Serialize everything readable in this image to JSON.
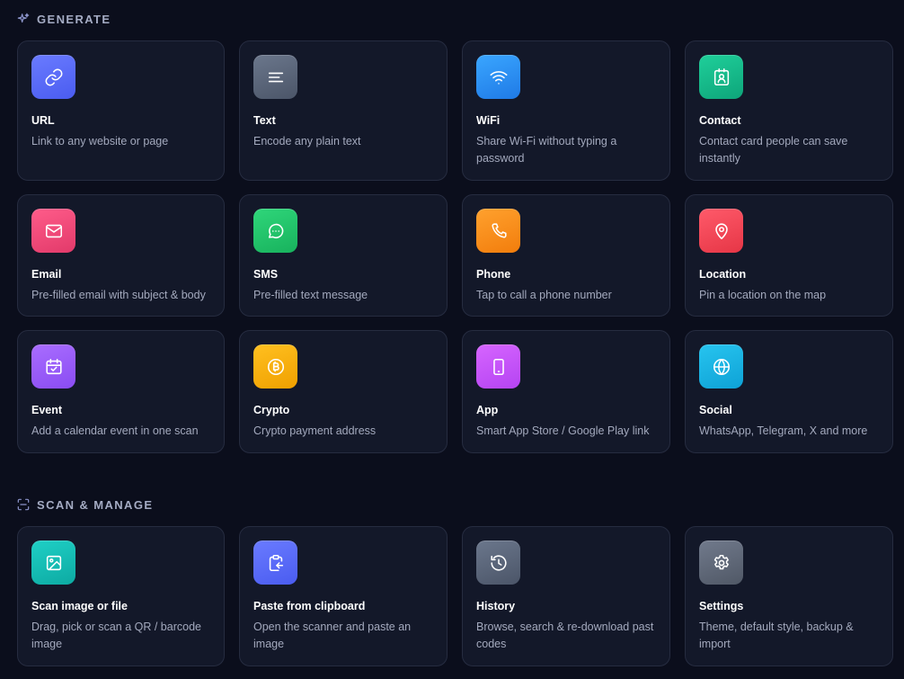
{
  "sections": {
    "generate": {
      "title": "GENERATE",
      "icon": "sparkles-icon",
      "cards": [
        {
          "title": "URL",
          "desc": "Link to any website or page",
          "icon": "link-icon",
          "gradient": [
            "#6a7bff",
            "#4a5cf0"
          ]
        },
        {
          "title": "Text",
          "desc": "Encode any plain text",
          "icon": "text-lines-icon",
          "gradient": [
            "#6b778c",
            "#4b5568"
          ]
        },
        {
          "title": "WiFi",
          "desc": "Share Wi-Fi without typing a password",
          "icon": "wifi-icon",
          "gradient": [
            "#3aa6ff",
            "#1f7ae6"
          ]
        },
        {
          "title": "Contact",
          "desc": "Contact card people can save instantly",
          "icon": "contact-card-icon",
          "gradient": [
            "#1fcf9a",
            "#0ea57a"
          ]
        },
        {
          "title": "Email",
          "desc": "Pre-filled email with subject & body",
          "icon": "mail-icon",
          "gradient": [
            "#ff5c8a",
            "#e23a6a"
          ]
        },
        {
          "title": "SMS",
          "desc": "Pre-filled text message",
          "icon": "chat-bubble-icon",
          "gradient": [
            "#2fd67a",
            "#18b25d"
          ]
        },
        {
          "title": "Phone",
          "desc": "Tap to call a phone number",
          "icon": "phone-icon",
          "gradient": [
            "#ffa12e",
            "#f27d0c"
          ]
        },
        {
          "title": "Location",
          "desc": "Pin a location on the map",
          "icon": "map-pin-icon",
          "gradient": [
            "#ff5a6a",
            "#e63646"
          ]
        },
        {
          "title": "Event",
          "desc": "Add a calendar event in one scan",
          "icon": "calendar-check-icon",
          "gradient": [
            "#a96dff",
            "#8a4cf2"
          ]
        },
        {
          "title": "Crypto",
          "desc": "Crypto payment address",
          "icon": "bitcoin-icon",
          "gradient": [
            "#ffc020",
            "#f0a000"
          ]
        },
        {
          "title": "App",
          "desc": "Smart App Store / Google Play link",
          "icon": "mobile-device-icon",
          "gradient": [
            "#d665ff",
            "#b544f2"
          ]
        },
        {
          "title": "Social",
          "desc": "WhatsApp, Telegram, X and more",
          "icon": "globe-icon",
          "gradient": [
            "#27c4ef",
            "#0ea2d6"
          ]
        }
      ]
    },
    "scan": {
      "title": "SCAN & MANAGE",
      "icon": "scan-frame-icon",
      "cards": [
        {
          "title": "Scan image or file",
          "desc": "Drag, pick or scan a QR / barcode image",
          "icon": "image-icon",
          "gradient": [
            "#1fd0c6",
            "#0daaa2"
          ]
        },
        {
          "title": "Paste from clipboard",
          "desc": "Open the scanner and paste an image",
          "icon": "clipboard-paste-icon",
          "gradient": [
            "#6a7bff",
            "#4a5cf0"
          ]
        },
        {
          "title": "History",
          "desc": "Browse, search & re-download past codes",
          "icon": "history-icon",
          "gradient": [
            "#6b778c",
            "#4b5568"
          ]
        },
        {
          "title": "Settings",
          "desc": "Theme, default style, backup & import",
          "icon": "gear-icon",
          "gradient": [
            "#717a8c",
            "#505866"
          ]
        }
      ]
    }
  },
  "colors": {
    "background": "#0b0e1c",
    "card": "#131829",
    "card_border": "#262c40",
    "section_title": "#a5acc4",
    "section_icon": "#8b93c9",
    "card_title": "#ffffff",
    "card_desc": "#a3a9bd"
  }
}
